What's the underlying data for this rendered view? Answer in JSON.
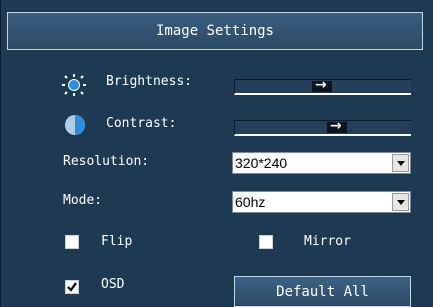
{
  "panel": {
    "title": "Image Settings"
  },
  "brightness": {
    "label": "Brightness:",
    "level": 0.5
  },
  "contrast": {
    "label": "Contrast:",
    "level": 0.6
  },
  "resolution": {
    "label": "Resolution:",
    "value": "320*240"
  },
  "mode": {
    "label": "Mode:",
    "value": "60hz"
  },
  "flip": {
    "label": "Flip",
    "checked": false
  },
  "mirror": {
    "label": "Mirror",
    "checked": false
  },
  "osd": {
    "label": "OSD",
    "checked": true
  },
  "default_all": {
    "label": "Default All"
  },
  "icons": {
    "brightness": "sun-icon",
    "contrast": "contrast-icon",
    "dropdown": "dropdown-arrow-icon",
    "check": "check-icon"
  },
  "colors": {
    "panel_bg": "#1e3a52",
    "icon_blue": "#2b8fe0",
    "text": "#ffffff"
  }
}
